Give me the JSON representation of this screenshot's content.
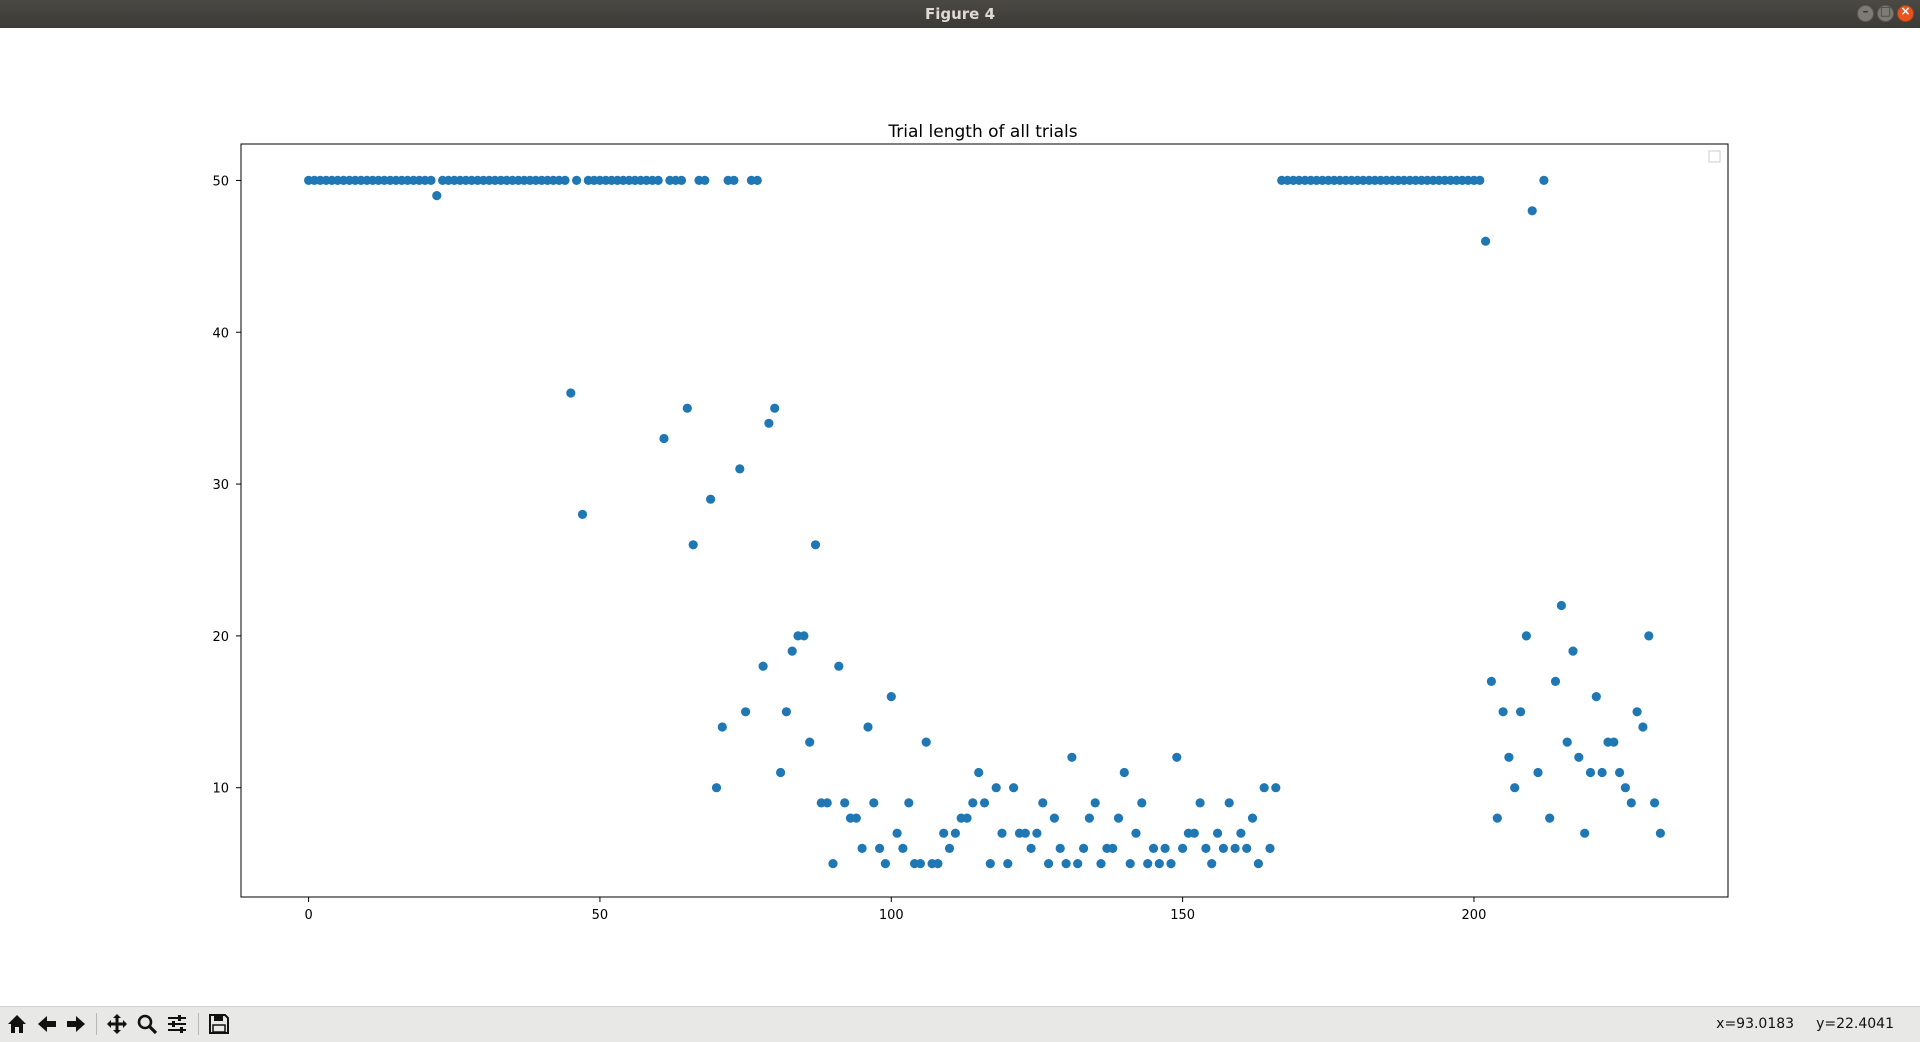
{
  "window": {
    "title": "Figure 4"
  },
  "toolbar": {
    "buttons": [
      "home-icon",
      "back-arrow-icon",
      "forward-arrow-icon",
      "pan-icon",
      "zoom-icon",
      "configure-subplots-icon",
      "save-icon"
    ],
    "coords": {
      "x": "x=93.0183",
      "y": "y=22.4041"
    }
  },
  "colors": {
    "marker": "#1f77b4",
    "titlebar": "#3c3b37",
    "close": "#e95420"
  },
  "chart_data": {
    "type": "scatter",
    "title": "Trial length of all trials",
    "xlabel": "",
    "ylabel": "",
    "xlim": [
      -11.6,
      243.6
    ],
    "ylim": [
      2.8,
      52.4
    ],
    "xticks": [
      0,
      50,
      100,
      150,
      200
    ],
    "yticks": [
      10,
      20,
      30,
      40,
      50
    ],
    "grid": false,
    "legend": "top-right (empty)",
    "x": [
      0,
      1,
      2,
      3,
      4,
      5,
      6,
      7,
      8,
      9,
      10,
      11,
      12,
      13,
      14,
      15,
      16,
      17,
      18,
      19,
      20,
      21,
      22,
      23,
      24,
      25,
      26,
      27,
      28,
      29,
      30,
      31,
      32,
      33,
      34,
      35,
      36,
      37,
      38,
      39,
      40,
      41,
      42,
      43,
      44,
      45,
      46,
      47,
      48,
      49,
      50,
      51,
      52,
      53,
      54,
      55,
      56,
      57,
      58,
      59,
      60,
      61,
      62,
      63,
      64,
      65,
      66,
      67,
      68,
      69,
      70,
      71,
      72,
      73,
      74,
      75,
      76,
      77,
      78,
      79,
      80,
      81,
      82,
      83,
      84,
      85,
      86,
      87,
      88,
      89,
      90,
      91,
      92,
      93,
      94,
      95,
      96,
      97,
      98,
      99,
      100,
      101,
      102,
      103,
      104,
      105,
      106,
      107,
      108,
      109,
      110,
      111,
      112,
      113,
      114,
      115,
      116,
      117,
      118,
      119,
      120,
      121,
      122,
      123,
      124,
      125,
      126,
      127,
      128,
      129,
      130,
      131,
      132,
      133,
      134,
      135,
      136,
      137,
      138,
      139,
      140,
      141,
      142,
      143,
      144,
      145,
      146,
      147,
      148,
      149,
      150,
      151,
      152,
      153,
      154,
      155,
      156,
      157,
      158,
      159,
      160,
      161,
      162,
      163,
      164,
      165,
      166,
      167,
      168,
      169,
      170,
      171,
      172,
      173,
      174,
      175,
      176,
      177,
      178,
      179,
      180,
      181,
      182,
      183,
      184,
      185,
      186,
      187,
      188,
      189,
      190,
      191,
      192,
      193,
      194,
      195,
      196,
      197,
      198,
      199,
      200,
      201,
      202,
      203,
      204,
      205,
      206,
      207,
      208,
      209,
      210,
      211,
      212,
      213,
      214,
      215,
      216,
      217,
      218,
      219,
      220,
      221,
      222,
      223,
      224,
      225,
      226,
      227,
      228,
      229,
      230,
      231,
      232
    ],
    "y": [
      50,
      50,
      50,
      50,
      50,
      50,
      50,
      50,
      50,
      50,
      50,
      50,
      50,
      50,
      50,
      50,
      50,
      50,
      50,
      50,
      50,
      50,
      49,
      50,
      50,
      50,
      50,
      50,
      50,
      50,
      50,
      50,
      50,
      50,
      50,
      50,
      50,
      50,
      50,
      50,
      50,
      50,
      50,
      50,
      50,
      36,
      50,
      28,
      50,
      50,
      50,
      50,
      50,
      50,
      50,
      50,
      50,
      50,
      50,
      50,
      50,
      33,
      50,
      50,
      50,
      35,
      26,
      50,
      50,
      29,
      10,
      14,
      50,
      50,
      31,
      15,
      50,
      50,
      18,
      34,
      35,
      11,
      15,
      19,
      20,
      20,
      13,
      26,
      9,
      9,
      5,
      18,
      9,
      8,
      8,
      6,
      14,
      9,
      6,
      5,
      16,
      7,
      6,
      9,
      5,
      5,
      13,
      5,
      5,
      7,
      6,
      7,
      8,
      8,
      9,
      11,
      9,
      5,
      10,
      7,
      5,
      10,
      7,
      7,
      6,
      7,
      9,
      5,
      8,
      6,
      5,
      12,
      5,
      6,
      8,
      9,
      5,
      6,
      6,
      8,
      11,
      5,
      7,
      9,
      5,
      6,
      5,
      6,
      5,
      12,
      6,
      7,
      7,
      9,
      6,
      5,
      7,
      6,
      9,
      6,
      7,
      6,
      8,
      5,
      10,
      6,
      10,
      50,
      50,
      50,
      50,
      50,
      50,
      50,
      50,
      50,
      50,
      50,
      50,
      50,
      50,
      50,
      50,
      50,
      50,
      50,
      50,
      50,
      50,
      50,
      50,
      50,
      50,
      50,
      50,
      50,
      50,
      50,
      50,
      50,
      50,
      50,
      46,
      17,
      8,
      15,
      12,
      10,
      15,
      20,
      48,
      11,
      50,
      8,
      17,
      22,
      13,
      19,
      12,
      7,
      11,
      16,
      11,
      13,
      13,
      11,
      10,
      9,
      15,
      14,
      20,
      9,
      7,
      7
    ]
  }
}
